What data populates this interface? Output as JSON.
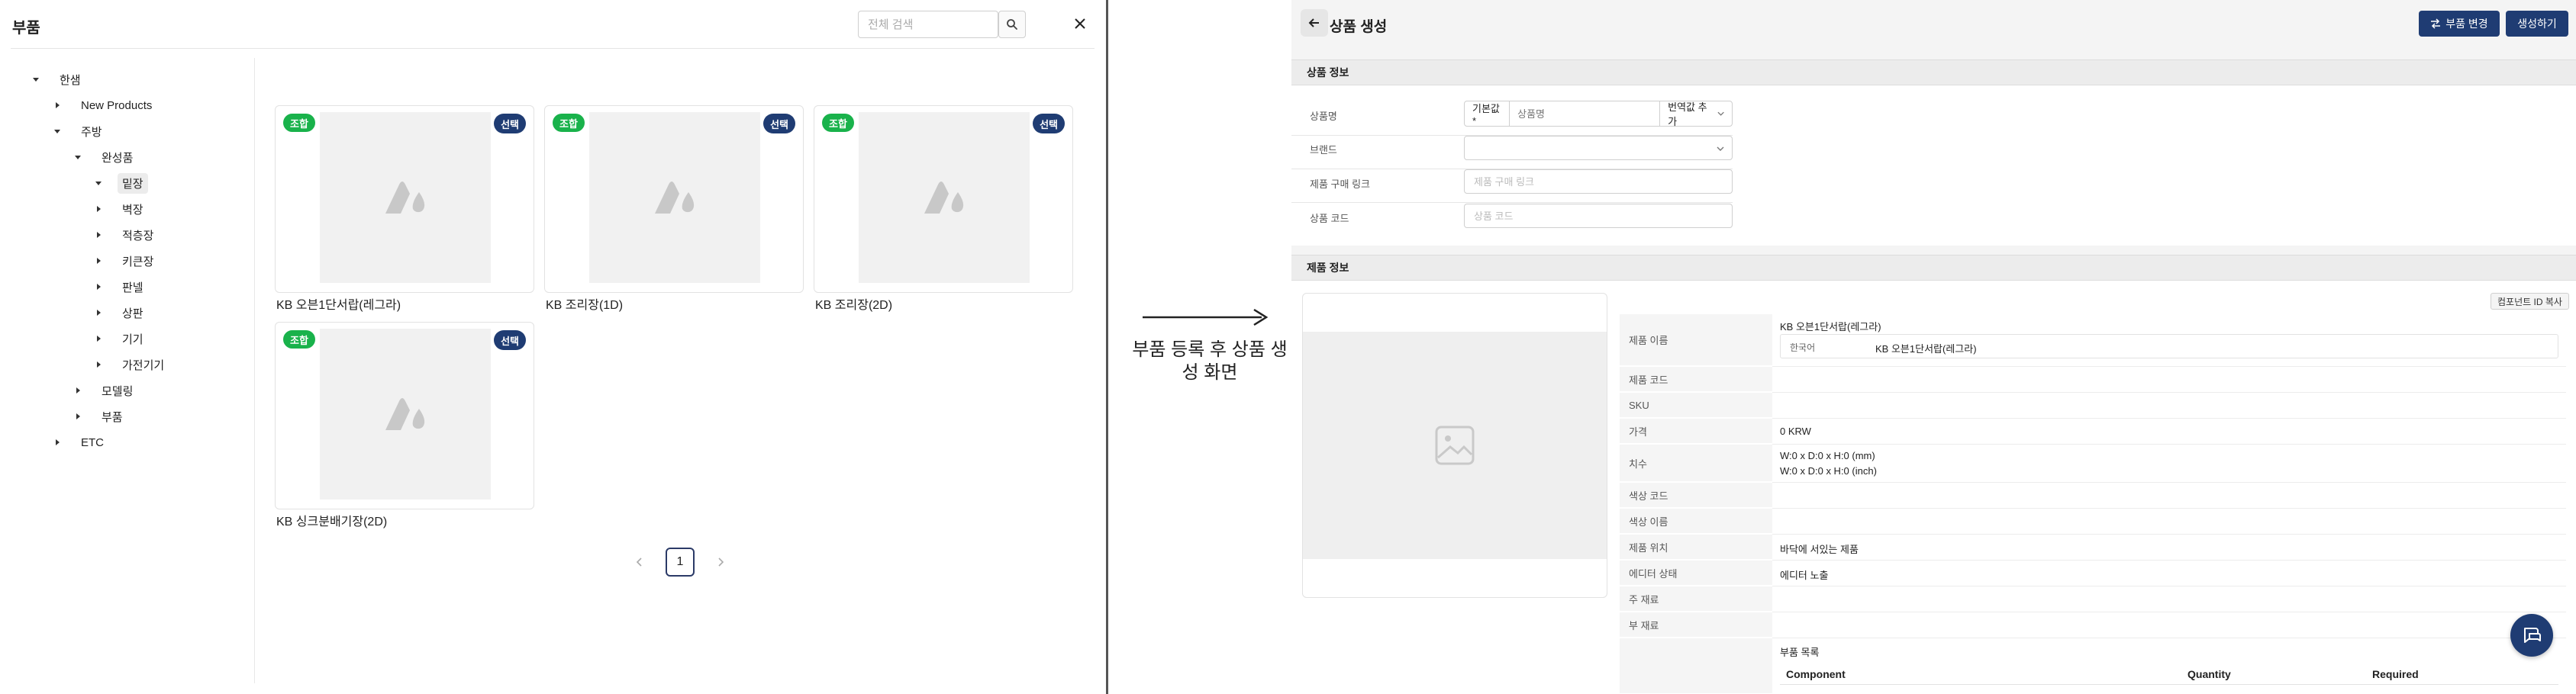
{
  "left": {
    "title": "부품",
    "search_placeholder": "전체 검색",
    "tree": [
      {
        "label": "한샘",
        "expanded": true
      },
      {
        "label": "New Products",
        "expanded": false
      },
      {
        "label": "주방",
        "expanded": true
      },
      {
        "label": "완성품",
        "expanded": true
      },
      {
        "label": "밑장",
        "expanded": true,
        "selected": true
      },
      {
        "label": "벽장",
        "expanded": false
      },
      {
        "label": "적층장",
        "expanded": false
      },
      {
        "label": "키큰장",
        "expanded": false
      },
      {
        "label": "판넬",
        "expanded": false
      },
      {
        "label": "상판",
        "expanded": false
      },
      {
        "label": "기기",
        "expanded": false
      },
      {
        "label": "가전기기",
        "expanded": false
      },
      {
        "label": "모델링",
        "expanded": false
      },
      {
        "label": "부품",
        "expanded": false
      },
      {
        "label": "ETC",
        "expanded": false
      }
    ],
    "cards": [
      {
        "badge": "조합",
        "select": "선택",
        "name": "KB 오븐1단서랍(레그라)"
      },
      {
        "badge": "조합",
        "select": "선택",
        "name": "KB 조리장(1D)"
      },
      {
        "badge": "조합",
        "select": "선택",
        "name": "KB 조리장(2D)"
      },
      {
        "badge": "조합",
        "select": "선택",
        "name": "KB 싱크분배기장(2D)"
      }
    ],
    "pagination": {
      "current": "1"
    }
  },
  "annotation": {
    "caption": "부품 등록 후 상품 생성 화면"
  },
  "right": {
    "title": "상품 생성",
    "buttons": {
      "change_part": "부품 변경",
      "create": "생성하기"
    },
    "product_info": {
      "header": "상품 정보",
      "name_label": "상품명",
      "default_tag": "기본값*",
      "name_placeholder": "상품명",
      "translation_label": "번역값 추가",
      "brand_label": "브랜드",
      "purchase_link_label": "제품 구매 링크",
      "purchase_link_placeholder": "제품 구매 링크",
      "code_label": "상품 코드",
      "code_placeholder": "상품 코드"
    },
    "item_info": {
      "header": "제품 정보",
      "copy_component_id": "컴포넌트 ID 복사",
      "rows": {
        "name_label": "제품 이름",
        "name_value": "KB 오븐1단서랍(레그라)",
        "lang_label": "한국어",
        "lang_value": "KB 오븐1단서랍(레그라)",
        "code_label": "제품 코드",
        "sku_label": "SKU",
        "price_label": "가격",
        "price_value": "0 KRW",
        "dims_label": "치수",
        "dims_mm": "W:0 x D:0 x H:0 (mm)",
        "dims_inch": "W:0 x D:0 x H:0 (inch)",
        "color_code_label": "색상 코드",
        "color_name_label": "색상 이름",
        "position_label": "제품 위치",
        "position_value": "바닥에 서있는 제품",
        "editor_state_label": "에디터 상태",
        "editor_state_value": "에디터 노출",
        "main_material_label": "주 재료",
        "sub_material_label": "부 재료",
        "parts_label": "부품 목록"
      },
      "parts_table": {
        "columns": [
          "Component",
          "Quantity",
          "Required"
        ]
      }
    }
  },
  "colors": {
    "navy": "#1f3c73",
    "green": "#19b24b",
    "panel_bg": "#f4f4f4"
  }
}
